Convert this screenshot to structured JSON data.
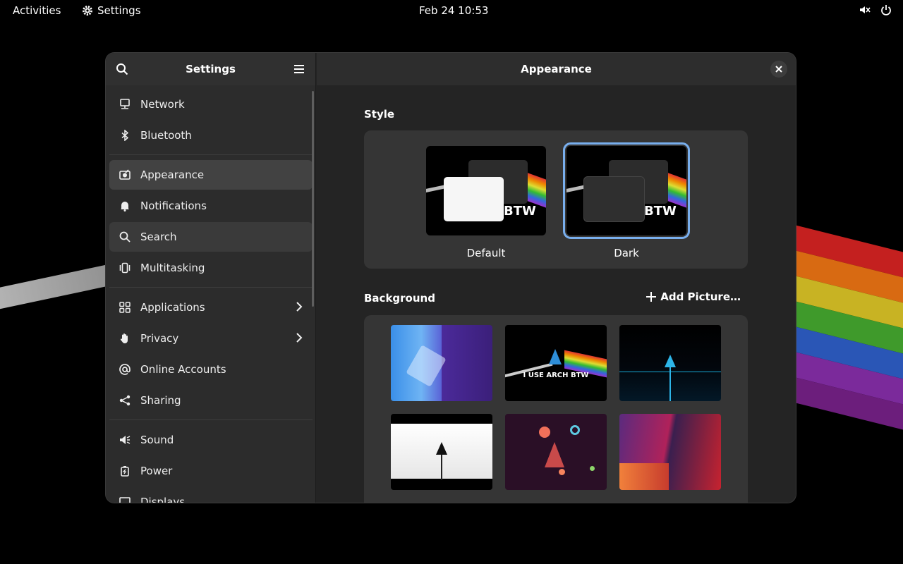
{
  "topbar": {
    "activities": "Activities",
    "app_name": "Settings",
    "clock": "Feb 24  10:53"
  },
  "sidebar": {
    "title": "Settings",
    "items": [
      {
        "label": "Network",
        "icon": "network-icon"
      },
      {
        "label": "Bluetooth",
        "icon": "bluetooth-icon"
      },
      {
        "label": "Appearance",
        "icon": "appearance-icon"
      },
      {
        "label": "Notifications",
        "icon": "bell-icon"
      },
      {
        "label": "Search",
        "icon": "search-icon"
      },
      {
        "label": "Multitasking",
        "icon": "multitasking-icon"
      },
      {
        "label": "Applications",
        "icon": "apps-grid-icon"
      },
      {
        "label": "Privacy",
        "icon": "hand-icon"
      },
      {
        "label": "Online Accounts",
        "icon": "at-icon"
      },
      {
        "label": "Sharing",
        "icon": "share-icon"
      },
      {
        "label": "Sound",
        "icon": "speaker-icon"
      },
      {
        "label": "Power",
        "icon": "battery-icon"
      },
      {
        "label": "Displays",
        "icon": "display-icon"
      }
    ]
  },
  "content": {
    "title": "Appearance",
    "style_section": "Style",
    "style_options": [
      {
        "label": "Default",
        "selected": false
      },
      {
        "label": "Dark",
        "selected": true
      }
    ],
    "thumb_text": "BTW",
    "background_section": "Background",
    "add_picture": "Add Picture…",
    "wallpaper_caption": "I USE ARCH BTW"
  },
  "colors": {
    "accent": "#78aeed",
    "window_bg": "#242424",
    "sidebar_bg": "#2c2c2c"
  }
}
